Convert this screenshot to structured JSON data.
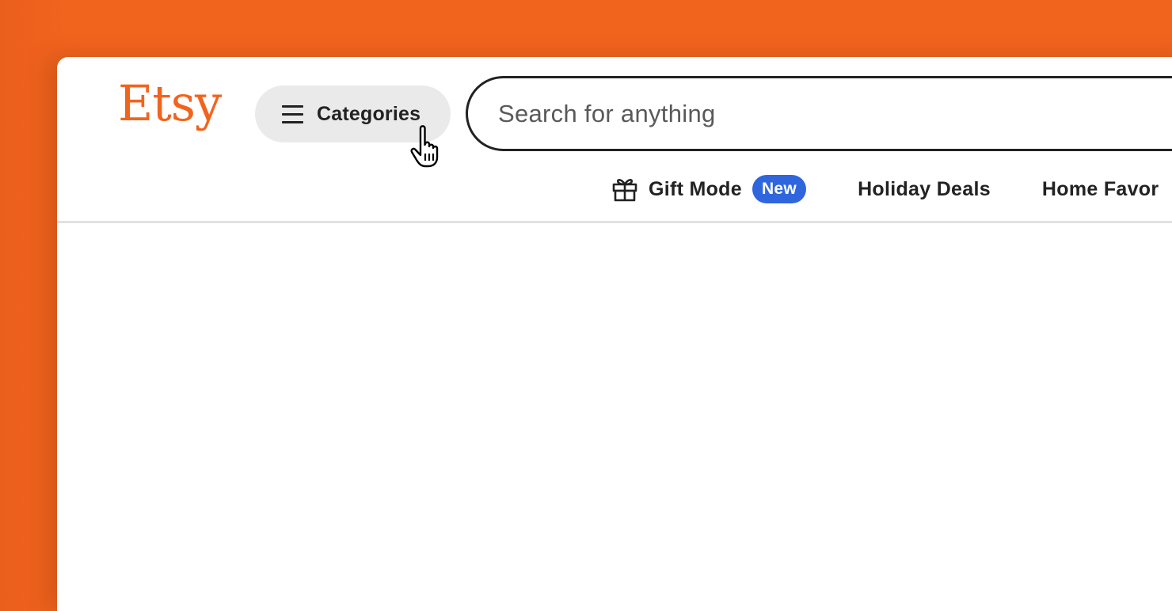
{
  "brand": {
    "logo_text": "Etsy",
    "color": "#F1641E"
  },
  "header": {
    "categories_label": "Categories",
    "search_placeholder": "Search for anything"
  },
  "nav": {
    "gift_mode_label": "Gift Mode",
    "gift_mode_badge": "New",
    "badge_color": "#2F66DE",
    "links": [
      {
        "label": "Holiday Deals"
      },
      {
        "label": "Home Favor"
      }
    ]
  },
  "icons": {
    "menu": "hamburger-icon",
    "gift": "gift-icon",
    "cursor": "hand-pointer-cursor-icon"
  }
}
